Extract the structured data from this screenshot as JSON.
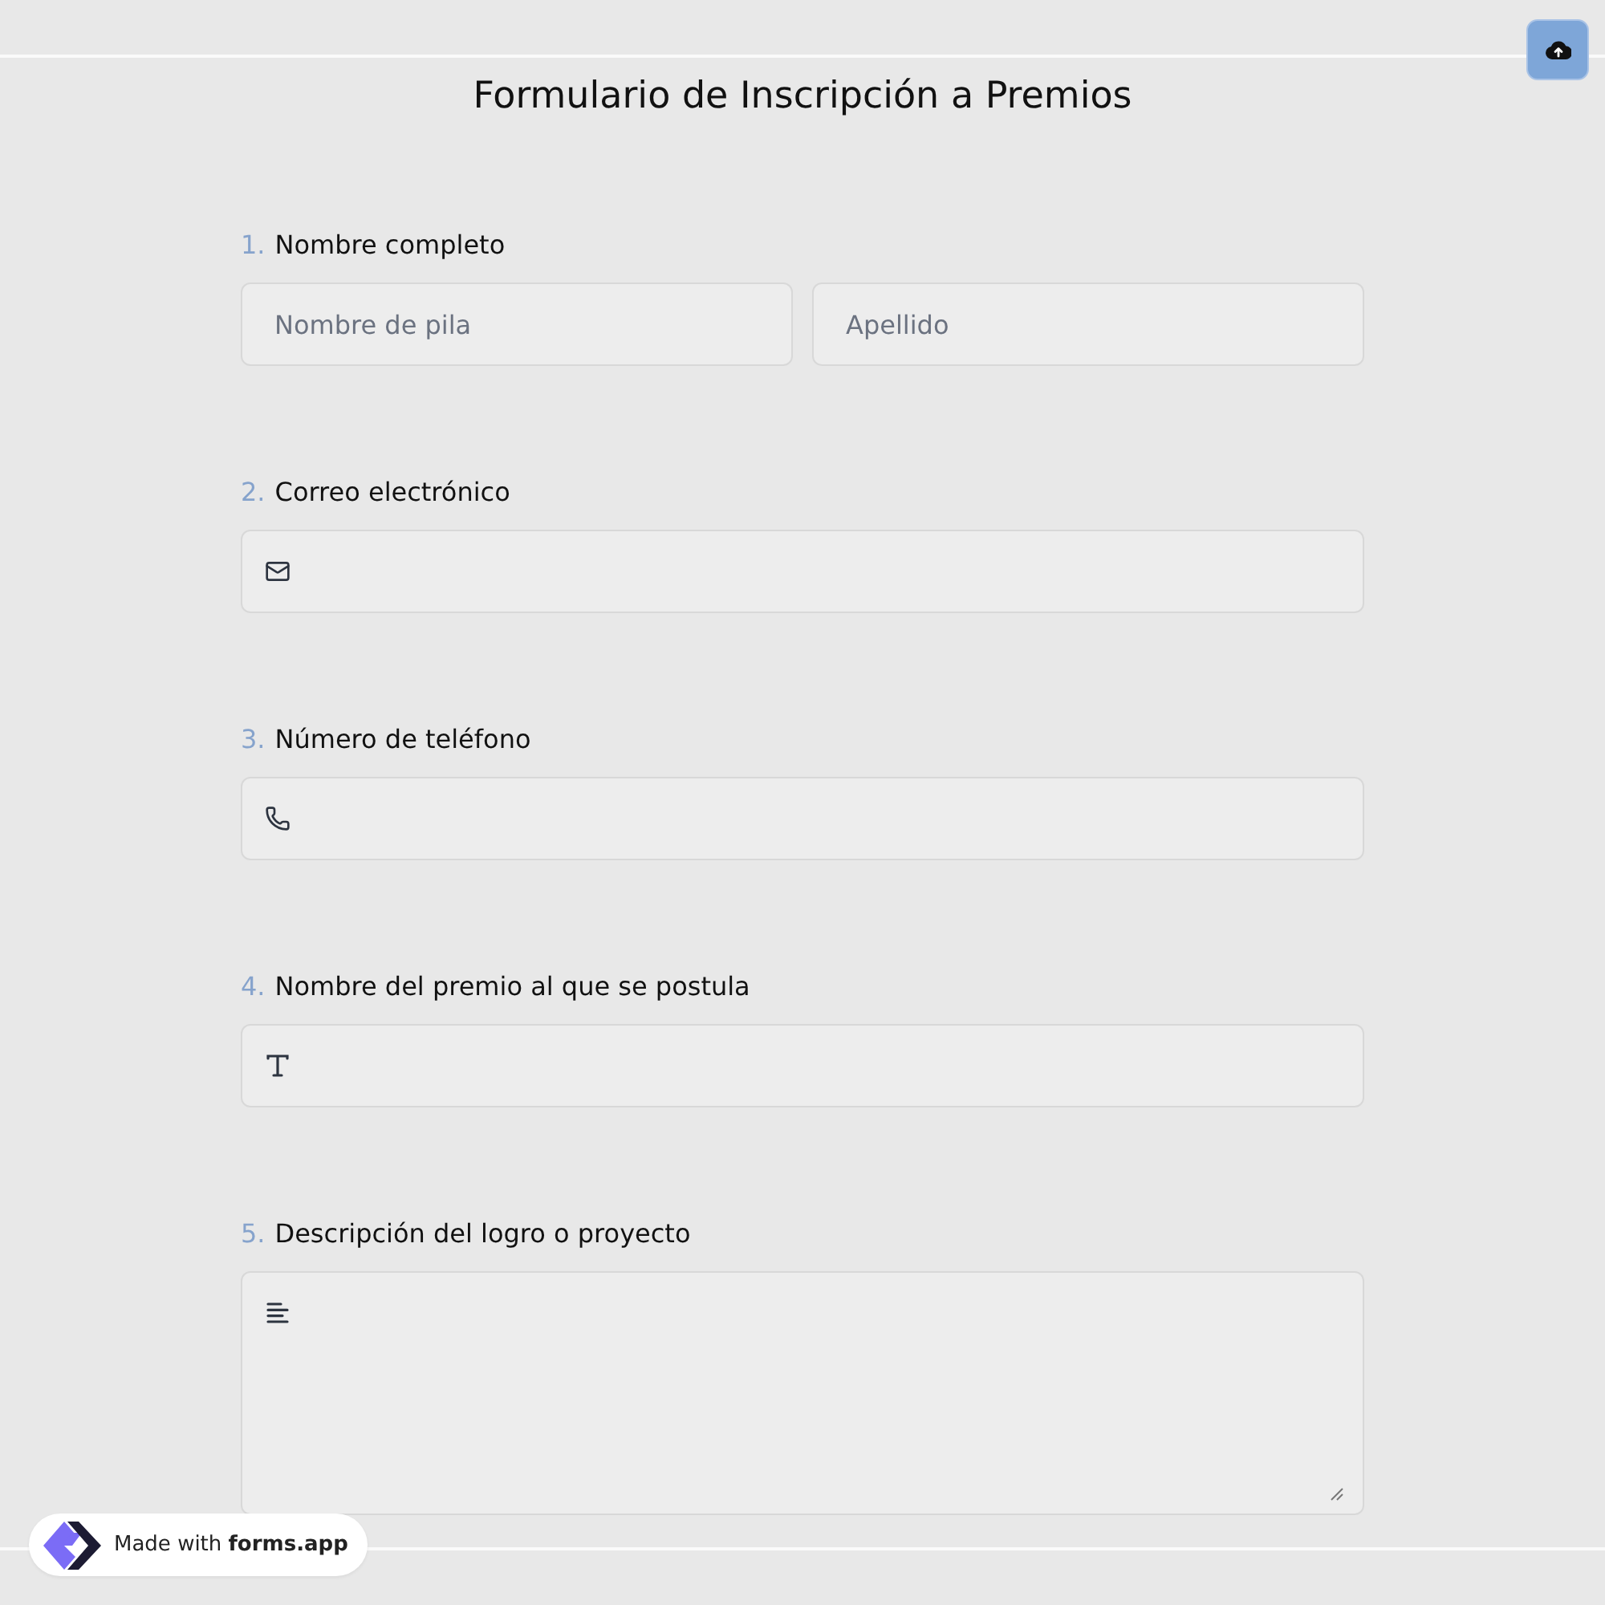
{
  "title": "Formulario de Inscripción a Premios",
  "questions": [
    {
      "number": "1.",
      "label": "Nombre completo",
      "kind": "name",
      "fields": [
        {
          "placeholder": "Nombre de pila"
        },
        {
          "placeholder": "Apellido"
        }
      ]
    },
    {
      "number": "2.",
      "label": "Correo electrónico",
      "kind": "email"
    },
    {
      "number": "3.",
      "label": "Número de teléfono",
      "kind": "phone"
    },
    {
      "number": "4.",
      "label": "Nombre del premio al que se postula",
      "kind": "text"
    },
    {
      "number": "5.",
      "label": "Descripción del logro o proyecto",
      "kind": "textarea"
    }
  ],
  "badge": {
    "text": "Made with **forms.app**"
  }
}
